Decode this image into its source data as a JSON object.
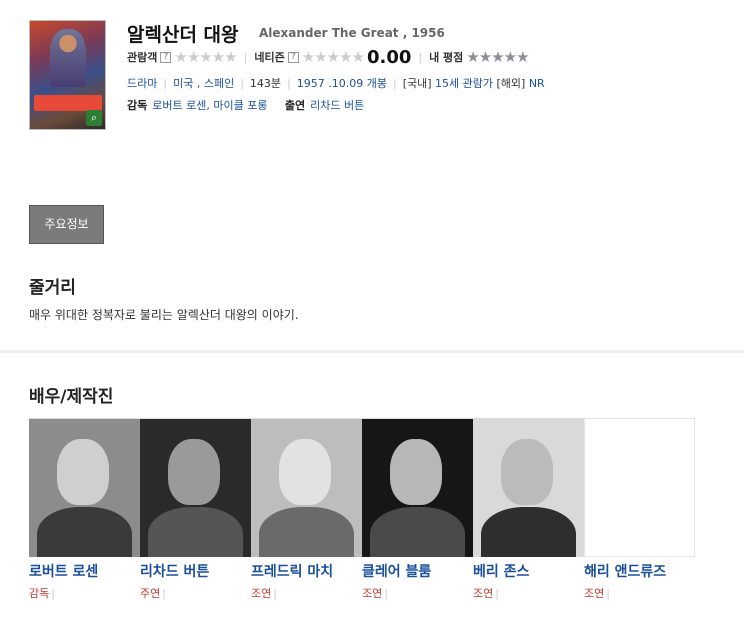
{
  "movie": {
    "title_ko": "알렉산더 대왕",
    "title_en": "Alexander The Great , 1956"
  },
  "ratings": {
    "audience_label": "관람객",
    "netizen_label": "네티즌",
    "netizen_score": "0.00",
    "my_label": "내 평점",
    "help_glyph": "?",
    "stars_glyph": "★★★★★"
  },
  "meta": {
    "genre": "드라마",
    "country": "미국 , 스페인",
    "runtime": "143분",
    "release": "1957 .10.09 개봉",
    "rating_kr_prefix": "[국내]",
    "rating_kr": "15세 관람가",
    "rating_intl_prefix": "[해외]",
    "rating_intl": "NR"
  },
  "credits": {
    "director_label": "감독",
    "director": "로버트 로센, 마이클 포롱",
    "cast_label": "출연",
    "cast": "리차드 버튼"
  },
  "tab": {
    "label": "주요정보"
  },
  "synopsis": {
    "heading": "줄거리",
    "text": "매우 위대한 정복자로 불리는 알렉산더 대왕의 이야기."
  },
  "cast_section": {
    "heading": "배우/제작진",
    "people": [
      {
        "name": "로버트 로센",
        "role": "감독"
      },
      {
        "name": "리차드 버튼",
        "role": "주연"
      },
      {
        "name": "프레드릭 마치",
        "role": "조연"
      },
      {
        "name": "클레어 블룸",
        "role": "조연"
      },
      {
        "name": "베리 존스",
        "role": "조연"
      },
      {
        "name": "해리 앤드류즈",
        "role": "조연"
      }
    ]
  },
  "colors": {
    "link": "#1a4f9c",
    "role": "#c0392b",
    "tab_bg": "#7b7b7b"
  },
  "icons": {
    "poster_zoom": "search-icon"
  }
}
